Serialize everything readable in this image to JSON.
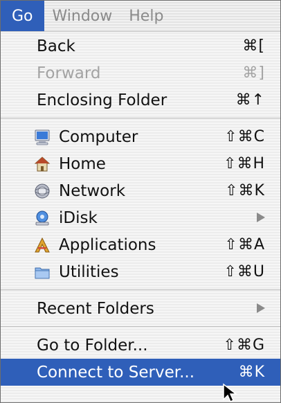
{
  "menubar": {
    "items": [
      {
        "label": "Go"
      },
      {
        "label": "Window"
      },
      {
        "label": "Help"
      }
    ]
  },
  "menu": {
    "back": {
      "label": "Back",
      "shortcut": "⌘["
    },
    "forward": {
      "label": "Forward",
      "shortcut": "⌘]"
    },
    "enclosing": {
      "label": "Enclosing Folder",
      "shortcut": "⌘↑"
    },
    "computer": {
      "label": "Computer",
      "shortcut": "⇧⌘C",
      "icon": "computer-icon"
    },
    "home": {
      "label": "Home",
      "shortcut": "⇧⌘H",
      "icon": "home-icon"
    },
    "network": {
      "label": "Network",
      "shortcut": "⇧⌘K",
      "icon": "network-icon"
    },
    "idisk": {
      "label": "iDisk",
      "icon": "idisk-icon"
    },
    "applications": {
      "label": "Applications",
      "shortcut": "⇧⌘A",
      "icon": "applications-icon"
    },
    "utilities": {
      "label": "Utilities",
      "shortcut": "⇧⌘U",
      "icon": "utilities-icon"
    },
    "recent": {
      "label": "Recent Folders"
    },
    "goto": {
      "label": "Go to Folder...",
      "shortcut": "⇧⌘G"
    },
    "connect": {
      "label": "Connect to Server...",
      "shortcut": "⌘K"
    }
  },
  "colors": {
    "highlight": "#2f5fb9",
    "disabled_text": "#a3a3a3"
  }
}
